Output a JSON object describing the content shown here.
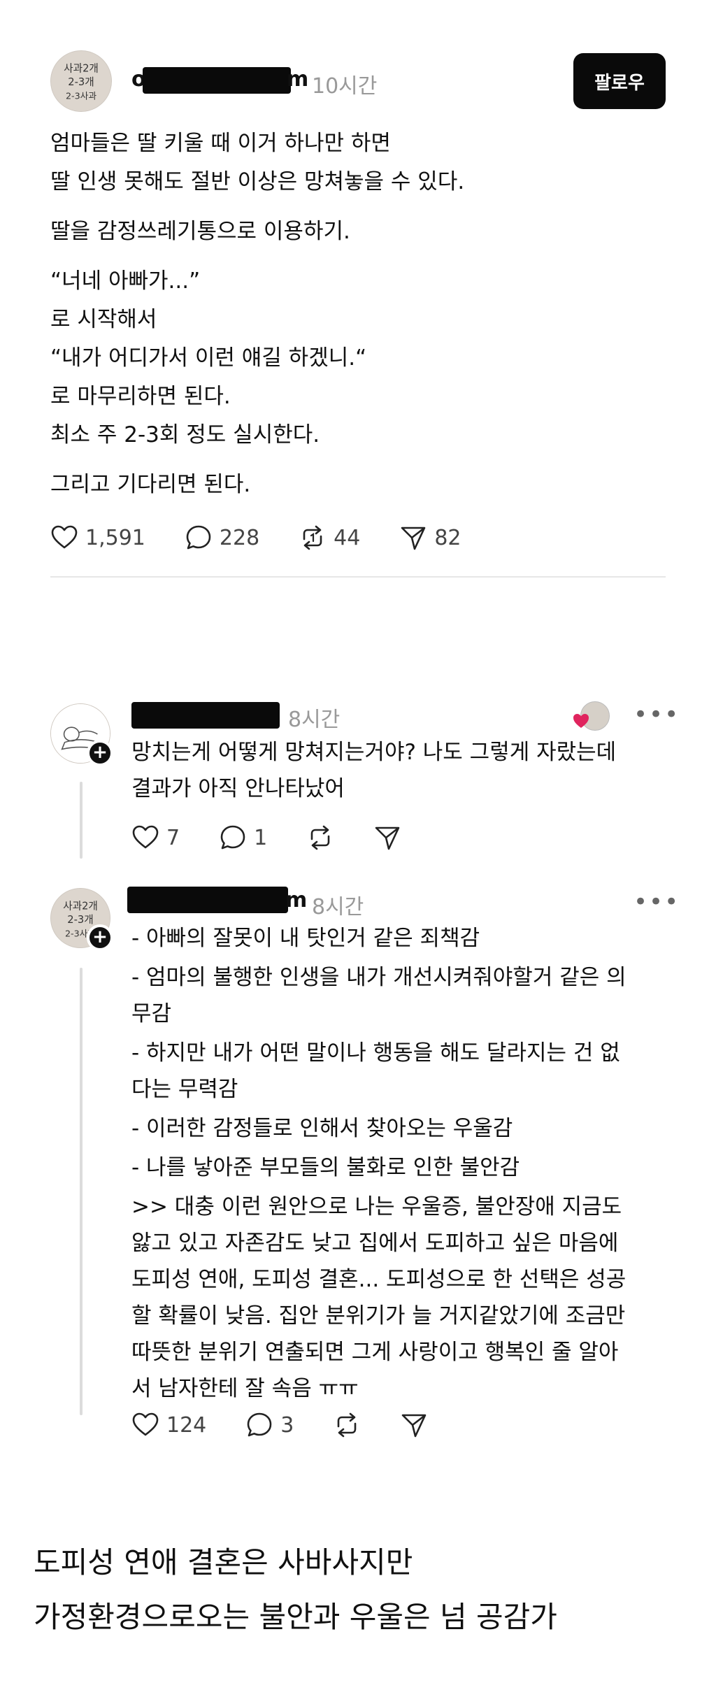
{
  "post": {
    "avatar_text": "사과 2개 2-3개 2-3개 사과",
    "username_visible_start": "o",
    "username_visible_end": "m",
    "time": "10시간",
    "follow_label": "팔로우",
    "lines": [
      "엄마들은 딸 키울 때 이거 하나만 하면\n딸 인생 못해도 절반 이상은 망쳐놓을 수 있다.",
      "딸을 감정쓰레기통으로 이용하기.",
      "“너네 아빠가...”\n로 시작해서\n“내가 어디가서 이런 얘길 하겠니.“\n로 마무리하면 된다.\n최소 주 2-3회 정도 실시한다.",
      "그리고 기다리면 된다."
    ],
    "likes": "1,591",
    "comments": "228",
    "reposts": "44",
    "shares": "82"
  },
  "reply1": {
    "time": "8시간",
    "more": "•••",
    "text": "망치는게 어떻게 망쳐지는거야? 나도 그렇게 자랐는데\n결과가 아직 안나타났어",
    "likes": "7",
    "comments": "1"
  },
  "reply2": {
    "username_visible_end": "m",
    "time": "8시간",
    "more": "•••",
    "lines": [
      "- 아빠의 잘못이 내 탓인거 같은 죄책감",
      "- 엄마의 불행한 인생을 내가 개선시켜줘야할거 같은 의\n무감",
      "- 하지만 내가 어떤 말이나 행동을 해도 달라지는 건 없\n다는 무력감",
      "- 이러한 감정들로 인해서 찾아오는 우울감",
      "- 나를 낳아준 부모들의 불화로 인한 불안감",
      ">> 대충 이런 원안으로 나는 우울증, 불안장애 지금도\n앓고 있고 자존감도 낮고 집에서 도피하고 싶은 마음에\n도피성 연애, 도피성 결혼... 도피성으로 한 선택은 성공\n할 확률이 낮음. 집안 분위기가 늘 거지같았기에 조금만\n따뜻한 분위기 연출되면 그게 사랑이고 행복인 줄 알아\n서 남자한테 잘 속음 ㅠㅠ"
    ],
    "likes": "124",
    "comments": "3"
  },
  "caption": {
    "line1": "도피성 연애 결혼은 사바사지만",
    "line2": "가정환경으로오는 불안과 우울은 넘 공감가"
  },
  "colors": {
    "text": "#101010",
    "muted": "#999999",
    "button": "#0a0a0a",
    "heart_badge": "#e0245e"
  }
}
